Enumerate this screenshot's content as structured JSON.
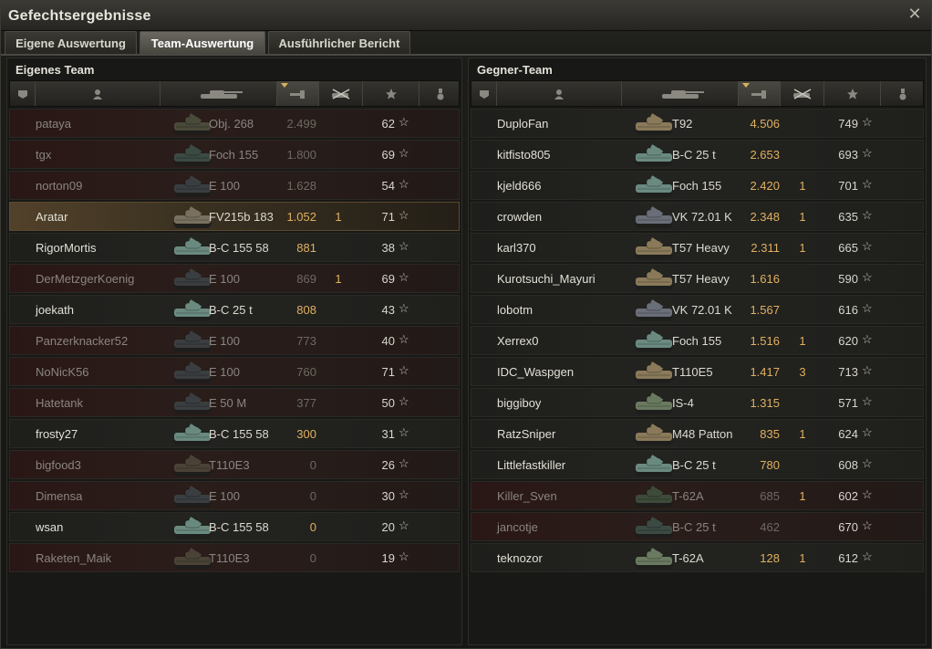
{
  "window": {
    "title": "Gefechtsergebnisse",
    "close_icon": "close-icon"
  },
  "tabs": [
    {
      "label": "Eigene Auswertung",
      "active": false
    },
    {
      "label": "Team-Auswertung",
      "active": true
    },
    {
      "label": "Ausführlicher Bericht",
      "active": false
    }
  ],
  "columns": [
    "squad-icon",
    "player-icon",
    "tank-icon",
    "damage-icon",
    "kills-icon",
    "xp-star-icon",
    "medal-icon"
  ],
  "left": {
    "title": "Eigenes Team",
    "rows": [
      {
        "name": "pataya",
        "vehicle": "Obj. 268",
        "damage": "2.499",
        "kills": "",
        "xp": "62",
        "dead": true,
        "me": false,
        "tank_color": "#4a4a3a"
      },
      {
        "name": "tgx",
        "vehicle": "Foch 155",
        "damage": "1.800",
        "kills": "",
        "xp": "69",
        "dead": true,
        "me": false,
        "tank_color": "#3c4a44"
      },
      {
        "name": "norton09",
        "vehicle": "E 100",
        "damage": "1.628",
        "kills": "",
        "xp": "54",
        "dead": true,
        "me": false,
        "tank_color": "#3a3e40"
      },
      {
        "name": "Aratar",
        "vehicle": "FV215b 183",
        "damage": "1.052",
        "kills": "1",
        "xp": "71",
        "dead": false,
        "me": true,
        "tank_color": "#7a7060"
      },
      {
        "name": "RigorMortis",
        "vehicle": "B-C 155 58",
        "damage": "881",
        "kills": "",
        "xp": "38",
        "dead": false,
        "me": false,
        "tank_color": "#6a8a80"
      },
      {
        "name": "DerMetzgerKoenig",
        "vehicle": "E 100",
        "damage": "869",
        "kills": "1",
        "xp": "69",
        "dead": true,
        "me": false,
        "tank_color": "#3a3e40"
      },
      {
        "name": "joekath",
        "vehicle": "B-C 25 t",
        "damage": "808",
        "kills": "",
        "xp": "43",
        "dead": false,
        "me": false,
        "tank_color": "#6a8a80"
      },
      {
        "name": "Panzerknacker52",
        "vehicle": "E 100",
        "damage": "773",
        "kills": "",
        "xp": "40",
        "dead": true,
        "me": false,
        "tank_color": "#3a3e40"
      },
      {
        "name": "NoNicK56",
        "vehicle": "E 100",
        "damage": "760",
        "kills": "",
        "xp": "71",
        "dead": true,
        "me": false,
        "tank_color": "#3a3e40"
      },
      {
        "name": "Hatetank",
        "vehicle": "E 50 M",
        "damage": "377",
        "kills": "",
        "xp": "50",
        "dead": true,
        "me": false,
        "tank_color": "#3a3e40"
      },
      {
        "name": "frosty27",
        "vehicle": "B-C 155 58",
        "damage": "300",
        "kills": "",
        "xp": "31",
        "dead": false,
        "me": false,
        "tank_color": "#6a8a80"
      },
      {
        "name": "bigfood3",
        "vehicle": "T110E3",
        "damage": "0",
        "kills": "",
        "xp": "26",
        "dead": true,
        "me": false,
        "tank_color": "#4a4236"
      },
      {
        "name": "Dimensa",
        "vehicle": "E 100",
        "damage": "0",
        "kills": "",
        "xp": "30",
        "dead": true,
        "me": false,
        "tank_color": "#3a3e40"
      },
      {
        "name": "wsan",
        "vehicle": "B-C 155 58",
        "damage": "0",
        "kills": "",
        "xp": "20",
        "dead": false,
        "me": false,
        "tank_color": "#6a8a80"
      },
      {
        "name": "Raketen_Maik",
        "vehicle": "T110E3",
        "damage": "0",
        "kills": "",
        "xp": "19",
        "dead": true,
        "me": false,
        "tank_color": "#4a4236"
      }
    ]
  },
  "right": {
    "title": "Gegner-Team",
    "rows": [
      {
        "name": "DuploFan",
        "vehicle": "T92",
        "damage": "4.506",
        "kills": "",
        "xp": "749",
        "dead": false,
        "me": false,
        "tank_color": "#8a7a5a"
      },
      {
        "name": "kitfisto805",
        "vehicle": "B-C 25 t",
        "damage": "2.653",
        "kills": "",
        "xp": "693",
        "dead": false,
        "me": false,
        "tank_color": "#6a8a80"
      },
      {
        "name": "kjeld666",
        "vehicle": "Foch 155",
        "damage": "2.420",
        "kills": "1",
        "xp": "701",
        "dead": false,
        "me": false,
        "tank_color": "#6a8a80"
      },
      {
        "name": "crowden",
        "vehicle": "VK 72.01 K",
        "damage": "2.348",
        "kills": "1",
        "xp": "635",
        "dead": false,
        "me": false,
        "tank_color": "#6a6e78"
      },
      {
        "name": "karl370",
        "vehicle": "T57 Heavy",
        "damage": "2.311",
        "kills": "1",
        "xp": "665",
        "dead": false,
        "me": false,
        "tank_color": "#8a7a5a"
      },
      {
        "name": "Kurotsuchi_Mayuri",
        "vehicle": "T57 Heavy",
        "damage": "1.616",
        "kills": "",
        "xp": "590",
        "dead": false,
        "me": false,
        "tank_color": "#8a7a5a"
      },
      {
        "name": "lobotm",
        "vehicle": "VK 72.01 K",
        "damage": "1.567",
        "kills": "",
        "xp": "616",
        "dead": false,
        "me": false,
        "tank_color": "#6a6e78"
      },
      {
        "name": "Xerrex0",
        "vehicle": "Foch 155",
        "damage": "1.516",
        "kills": "1",
        "xp": "620",
        "dead": false,
        "me": false,
        "tank_color": "#6a8a80"
      },
      {
        "name": "IDC_Waspgen",
        "vehicle": "T110E5",
        "damage": "1.417",
        "kills": "3",
        "xp": "713",
        "dead": false,
        "me": false,
        "tank_color": "#8a7a5a"
      },
      {
        "name": "biggiboy",
        "vehicle": "IS-4",
        "damage": "1.315",
        "kills": "",
        "xp": "571",
        "dead": false,
        "me": false,
        "tank_color": "#6a7a60"
      },
      {
        "name": "RatzSniper",
        "vehicle": "M48 Patton",
        "damage": "835",
        "kills": "1",
        "xp": "624",
        "dead": false,
        "me": false,
        "tank_color": "#8a7a5a"
      },
      {
        "name": "Littlefastkiller",
        "vehicle": "B-C 25 t",
        "damage": "780",
        "kills": "",
        "xp": "608",
        "dead": false,
        "me": false,
        "tank_color": "#6a8a80"
      },
      {
        "name": "Killer_Sven",
        "vehicle": "T-62A",
        "damage": "685",
        "kills": "1",
        "xp": "602",
        "dead": true,
        "me": false,
        "tank_color": "#3e4a3a"
      },
      {
        "name": "jancotje",
        "vehicle": "B-C 25 t",
        "damage": "462",
        "kills": "",
        "xp": "670",
        "dead": true,
        "me": false,
        "tank_color": "#3c4a44"
      },
      {
        "name": "teknozor",
        "vehicle": "T-62A",
        "damage": "128",
        "kills": "1",
        "xp": "612",
        "dead": false,
        "me": false,
        "tank_color": "#6a7a60"
      }
    ]
  },
  "footer_text": ""
}
